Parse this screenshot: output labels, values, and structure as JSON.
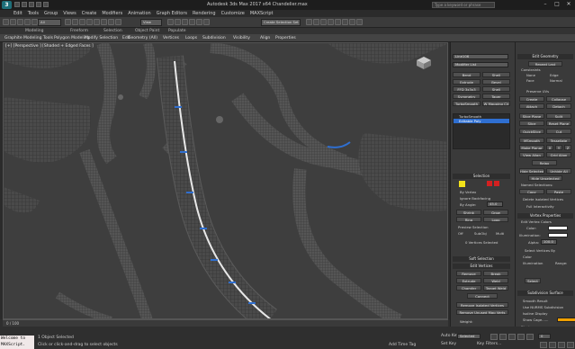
{
  "app": {
    "title": "Autodesk 3ds Max 2017 x64    Chandelier.max",
    "search_placeholder": "Type a keyword or phrase",
    "logo_text": "3"
  },
  "menus": [
    "Edit",
    "Tools",
    "Group",
    "Views",
    "Create",
    "Modifiers",
    "Animation",
    "Graph Editors",
    "Rendering",
    "Customize",
    "MAXScript",
    "Help"
  ],
  "toolbar": {
    "selection_filter": "All",
    "view_dropdown": "View",
    "named_sel": "Create Selection Set"
  },
  "ribbon_tabs": [
    "Modeling",
    "Freeform",
    "Selection",
    "Object Paint",
    "Populate"
  ],
  "ribbon_row": [
    "Graphite Modeling Tools",
    "Polygon Modeling",
    "Modify Selection",
    "Edit",
    "Geometry (All)",
    "Vertices",
    "Loops",
    "Subdivision",
    "Visibility",
    "Align",
    "Properties"
  ],
  "viewport": {
    "label": "[+] [Perspective ] [Shaded + Edged Faces ]"
  },
  "command_panel": {
    "object_name": "Line106",
    "modifier_list": "Modifier List",
    "mod_buttons": [
      "Bend",
      "Shell",
      "Extrude",
      "Bevel",
      "FFD 3x3x3",
      "Shell",
      "Symmetry",
      "Taper",
      "TurboSmooth",
      "W Mapping Clr"
    ],
    "stack": [
      "TurboSmooth",
      "Editable Poly"
    ],
    "selection": {
      "title": "Selection",
      "by_vertex": "By Vertex",
      "ignore_backfacing": "Ignore Backfacing",
      "by_angle": "By Angle:",
      "angle_value": "45.0",
      "shrink": "Shrink",
      "grow": "Grow",
      "ring": "Ring",
      "loop": "Loop",
      "preview_selection": "Preview Selection",
      "preview_off": "Off",
      "preview_subobj": "SubObj",
      "preview_multi": "Multi",
      "status": "0 Vertices Selected"
    },
    "soft_selection": "Soft Selection",
    "edit_vertices": {
      "title": "Edit Vertices",
      "remove": "Remove",
      "break": "Break",
      "extrude": "Extrude",
      "weld": "Weld",
      "chamfer": "Chamfer",
      "target_weld": "Target Weld",
      "connect": "Connect",
      "remove_isolated": "Remove Isolated Vertices",
      "remove_unused": "Remove Unused Map Verts",
      "weight_label": "Weight:"
    }
  },
  "command_panel2": {
    "edit_geometry": "Edit Geometry",
    "repeat_last": "Repeat Last",
    "constraints": "Constraints",
    "c_none": "None",
    "c_edge": "Edge",
    "c_face": "Face",
    "c_normal": "Normal",
    "preserve_uvs": "Preserve UVs",
    "create": "Create",
    "collapse": "Collapse",
    "attach": "Attach",
    "detach": "Detach",
    "slice_plane": "Slice Plane",
    "split": "Split",
    "slice": "Slice",
    "reset_plane": "Reset Plane",
    "quickslice": "QuickSlice",
    "cut": "Cut",
    "msmooth": "MSmooth",
    "tessellate": "Tessellate",
    "make_planar": "Make Planar",
    "x": "X",
    "y": "Y",
    "z": "Z",
    "view_align": "View Align",
    "grid_align": "Grid Align",
    "relax": "Relax",
    "hide_selected": "Hide Selected",
    "unhide_all": "Unhide All",
    "hide_unselected": "Hide Unselected",
    "named_selections": "Named Selections:",
    "copy": "Copy",
    "paste": "Paste",
    "delete_isolated": "Delete Isolated Vertices",
    "full_interactivity": "Full Interactivity",
    "vertex_properties": "Vertex Properties",
    "edit_vertex_colors": "Edit Vertex Colors",
    "color_label": "Color:",
    "illumination_label": "Illumination:",
    "alpha_label": "Alpha:",
    "alpha_value": "100.0",
    "select_vertices_by": "Select Vertices By",
    "svb_color": "Color",
    "svb_illumination": "Illumination",
    "range_label": "Range:",
    "select_btn": "Select",
    "subdivision_surface": "Subdivision Surface",
    "smooth_result": "Smooth Result",
    "use_nurms": "Use NURMS Subdivision",
    "isoline_display": "Isoline Display",
    "show_cage": "Show Cage......",
    "display": "Display"
  },
  "status": {
    "objects_selected": "1 Object Selected",
    "prompt": "Click or click-and-drag to select objects",
    "maxscript": "Welcome to MAXScript.",
    "timeline_pos": "0 / 100",
    "auto_key": "Auto Key",
    "selected": "Selected",
    "set_key": "Set Key",
    "key_filters": "Key Filters...",
    "add_time_tag": "Add Time Tag",
    "frame": "0",
    "grid": "Grid = 10.0"
  },
  "colors": {
    "accent_blue": "#2f6fd1",
    "wire": "#8a8a8a",
    "bg_dark": "#2b2b2b",
    "panel": "#3a3a3a",
    "selection_yellow": "#f2e21a",
    "red_btn": "#d42020"
  }
}
